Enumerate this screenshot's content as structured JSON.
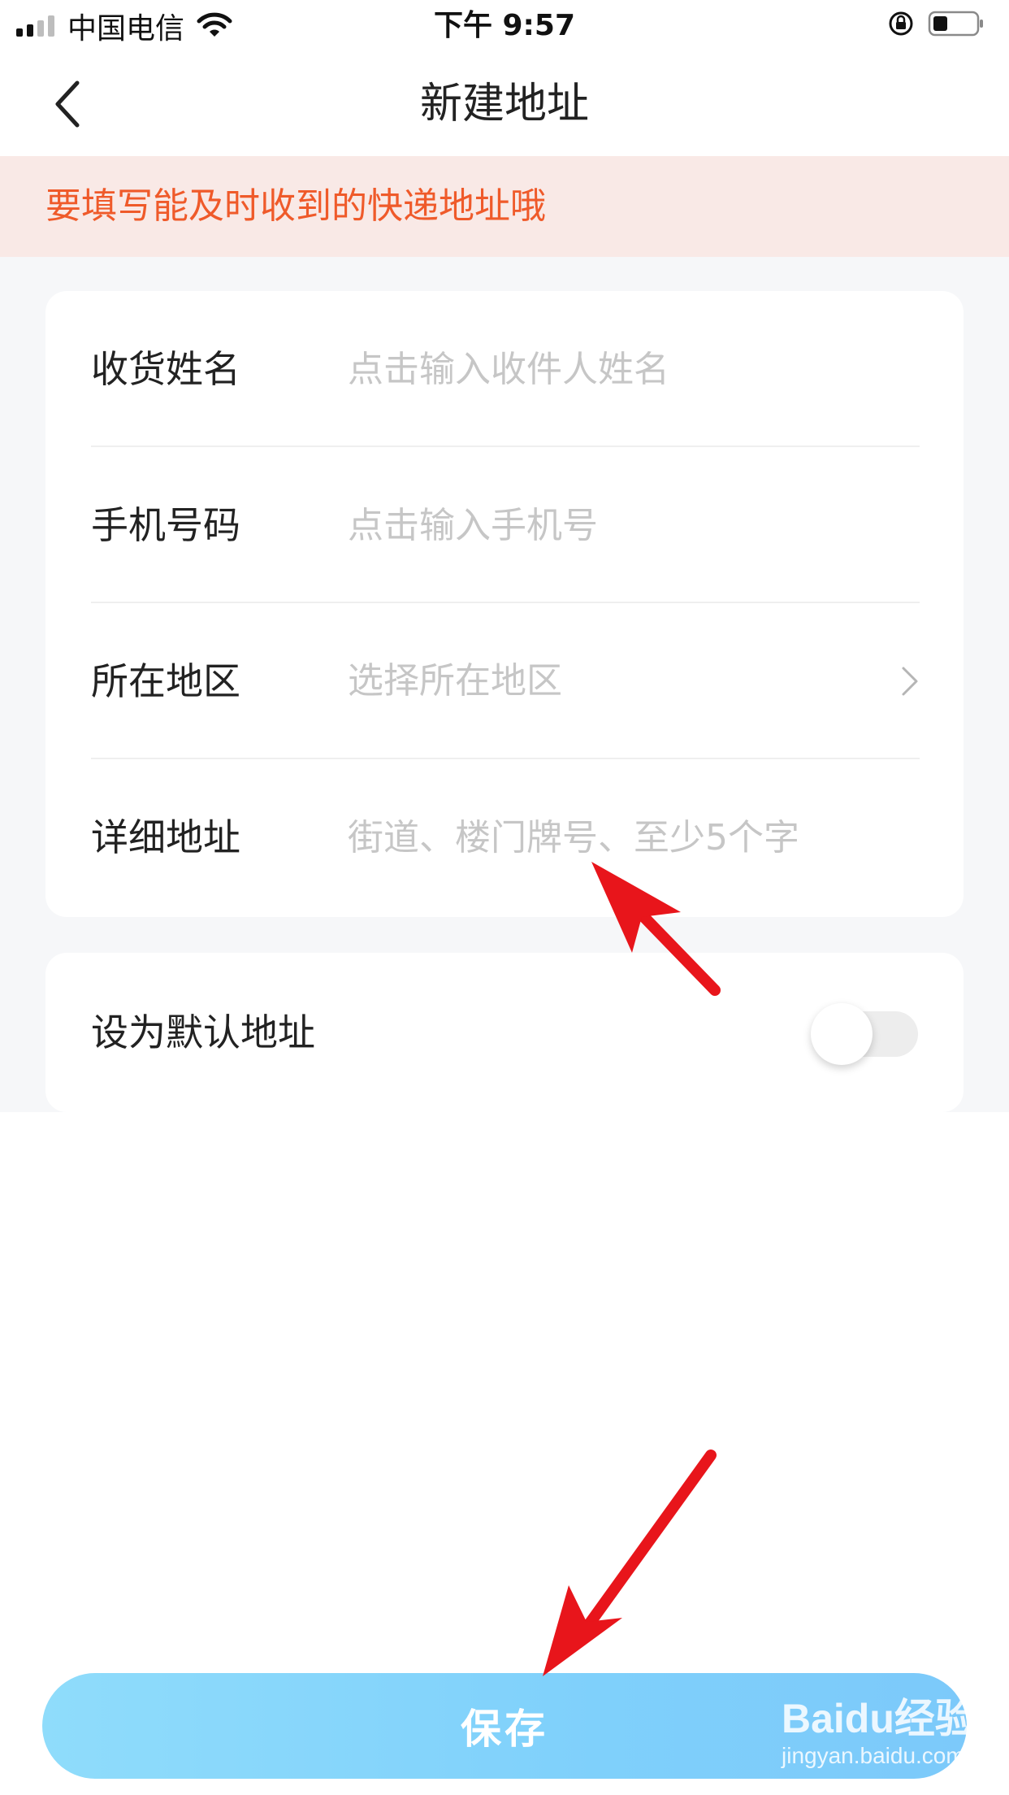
{
  "status_bar": {
    "carrier": "中国电信",
    "time": "下午 9:57"
  },
  "nav": {
    "title": "新建地址"
  },
  "notice": {
    "text": "要填写能及时收到的快递地址哦"
  },
  "form": {
    "rows": [
      {
        "label": "收货姓名",
        "placeholder": "点击输入收件人姓名"
      },
      {
        "label": "手机号码",
        "placeholder": "点击输入手机号"
      },
      {
        "label": "所在地区",
        "placeholder": "选择所在地区"
      },
      {
        "label": "详细地址",
        "placeholder": "街道、楼门牌号、至少5个字"
      }
    ]
  },
  "default_address": {
    "label": "设为默认地址",
    "enabled": false
  },
  "save": {
    "label": "保存"
  },
  "watermark": {
    "logo": "Baidu经验",
    "url": "jingyan.baidu.com"
  },
  "colors": {
    "notice_bg": "#f9e9e6",
    "notice_text": "#ef5a2a",
    "save_button": "#82d4fb",
    "annotation_arrow": "#e8151b"
  }
}
